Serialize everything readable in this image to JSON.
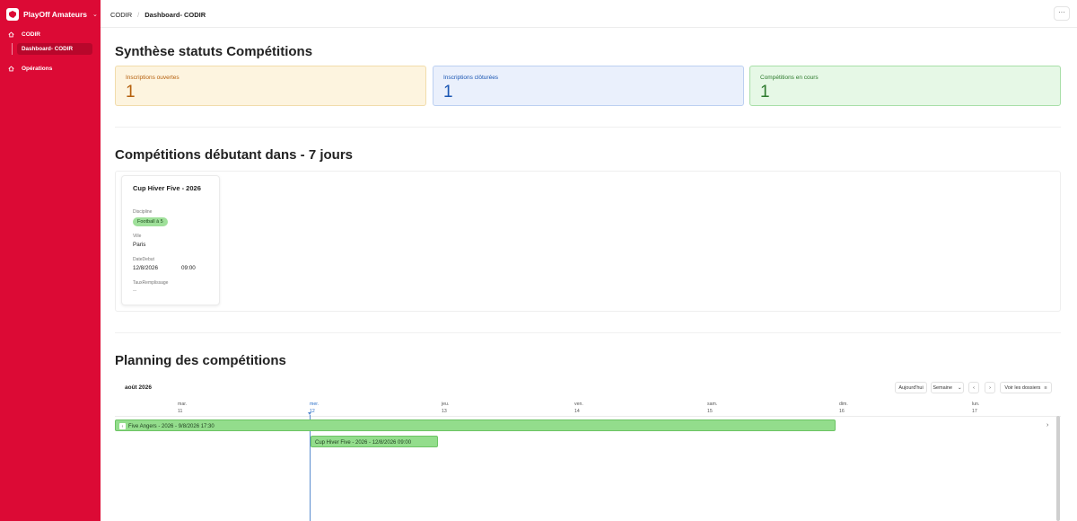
{
  "brand": {
    "name": "PlayOff Amateurs"
  },
  "sidebar": {
    "items": [
      {
        "label": "CODIR"
      },
      {
        "label": "Dashboard- CODIR"
      },
      {
        "label": "Opérations"
      }
    ]
  },
  "breadcrumb": {
    "root": "CODIR",
    "current": "Dashboard- CODIR"
  },
  "header": {
    "more_label": "···"
  },
  "synthese": {
    "title": "Synthèse statuts Compétitions",
    "cards": [
      {
        "label": "Inscriptions ouvertes",
        "value": "1",
        "color": "#b5600d"
      },
      {
        "label": "Inscriptions clôturées",
        "value": "1",
        "color": "#1a56b3"
      },
      {
        "label": "Compétitions en cours",
        "value": "1",
        "color": "#2d7a2d"
      }
    ]
  },
  "upcoming": {
    "title": "Compétitions débutant dans - 7 jours",
    "card": {
      "name": "Cup Hiver Five - 2026",
      "discipline_label": "Discipline",
      "discipline": "Football à 5",
      "ville_label": "Ville",
      "ville": "Paris",
      "date_label": "DateDebut",
      "date": "12/8/2026",
      "time": "09:00",
      "taux_label": "TauxRemplissage",
      "taux": "--"
    }
  },
  "planning": {
    "title": "Planning des compétitions",
    "month": "août 2026",
    "today_label": "Aujourd'hui",
    "view_label": "Semaine",
    "files_label": "Voir les dossiers",
    "days": [
      {
        "name": "mar.",
        "num": "11"
      },
      {
        "name": "mer.",
        "num": "12"
      },
      {
        "name": "jeu.",
        "num": "13"
      },
      {
        "name": "ven.",
        "num": "14"
      },
      {
        "name": "sam.",
        "num": "15"
      },
      {
        "name": "dim.",
        "num": "16"
      },
      {
        "name": "lun.",
        "num": "17"
      }
    ],
    "events": [
      {
        "label": "Five Angers - 2026 - 9/8/2026 17:30"
      },
      {
        "label": "Cup Hiver Five - 2026 - 12/8/2026 09:00"
      }
    ]
  },
  "colors": {
    "sidebar": "#dc0a35",
    "event": "#93dd8c"
  }
}
